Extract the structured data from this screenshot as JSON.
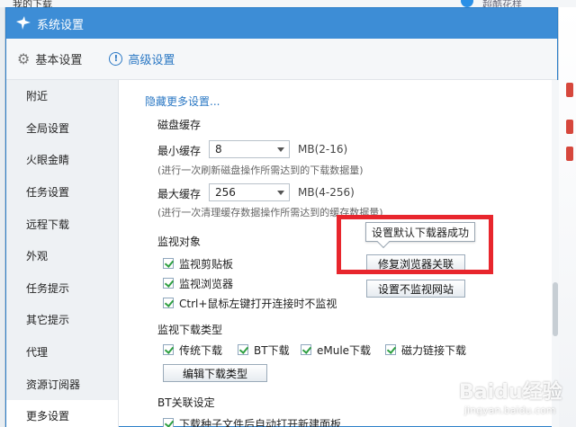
{
  "background": {
    "top_left_text": "我的下载",
    "top_right_text": "超酷花样"
  },
  "window": {
    "title": "系统设置"
  },
  "tabs": [
    {
      "label": "基本设置",
      "icon": "gear-icon"
    },
    {
      "label": "高级设置",
      "icon": "info-icon"
    }
  ],
  "sidebar": {
    "items": [
      {
        "label": "附近"
      },
      {
        "label": "全局设置"
      },
      {
        "label": "火眼金睛"
      },
      {
        "label": "任务设置"
      },
      {
        "label": "远程下载"
      },
      {
        "label": "外观"
      },
      {
        "label": "任务提示"
      },
      {
        "label": "其它提示"
      },
      {
        "label": "代理"
      },
      {
        "label": "资源订阅器"
      },
      {
        "label": "更多设置"
      }
    ],
    "active_index": 10
  },
  "content": {
    "hide_more_link": "隐藏更多设置...",
    "disk_cache": {
      "title": "磁盘缓存",
      "min_label": "最小缓存",
      "min_value": "8",
      "min_range": "MB(2-16)",
      "min_hint": "(进行一次刷新磁盘操作所需达到的下载数据量)",
      "max_label": "最大缓存",
      "max_value": "256",
      "max_range": "MB(4-256)",
      "max_hint": "(进行一次清理缓存数据操作所需达到的缓存数据量)"
    },
    "monitor_object": {
      "title": "监视对象",
      "options": [
        {
          "label": "监视剪贴板",
          "checked": true
        },
        {
          "label": "监视浏览器",
          "checked": true
        },
        {
          "label": "Ctrl+鼠标左键打开连接时不监视",
          "checked": true
        }
      ],
      "repair_button": "修复浏览器关联",
      "no_monitor_button": "设置不监视网站",
      "tooltip": "设置默认下载器成功"
    },
    "monitor_types": {
      "title": "监视下载类型",
      "options": [
        {
          "label": "传统下载",
          "checked": true
        },
        {
          "label": "BT下载",
          "checked": true
        },
        {
          "label": "eMule下载",
          "checked": true
        },
        {
          "label": "磁力链接下载",
          "checked": true
        }
      ],
      "edit_button": "编辑下载类型"
    },
    "bt": {
      "title": "BT关联设定",
      "options": [
        {
          "label": "下载种子文件后自动打开新建面板",
          "checked": true
        }
      ]
    }
  },
  "watermark": {
    "text": "Baidu经验",
    "url": "jingyan.baidu.com"
  },
  "colors": {
    "titlebar": "#3d8dd6",
    "link": "#2b78c4",
    "highlight_box": "#e8262d",
    "check": "#2fa042"
  }
}
